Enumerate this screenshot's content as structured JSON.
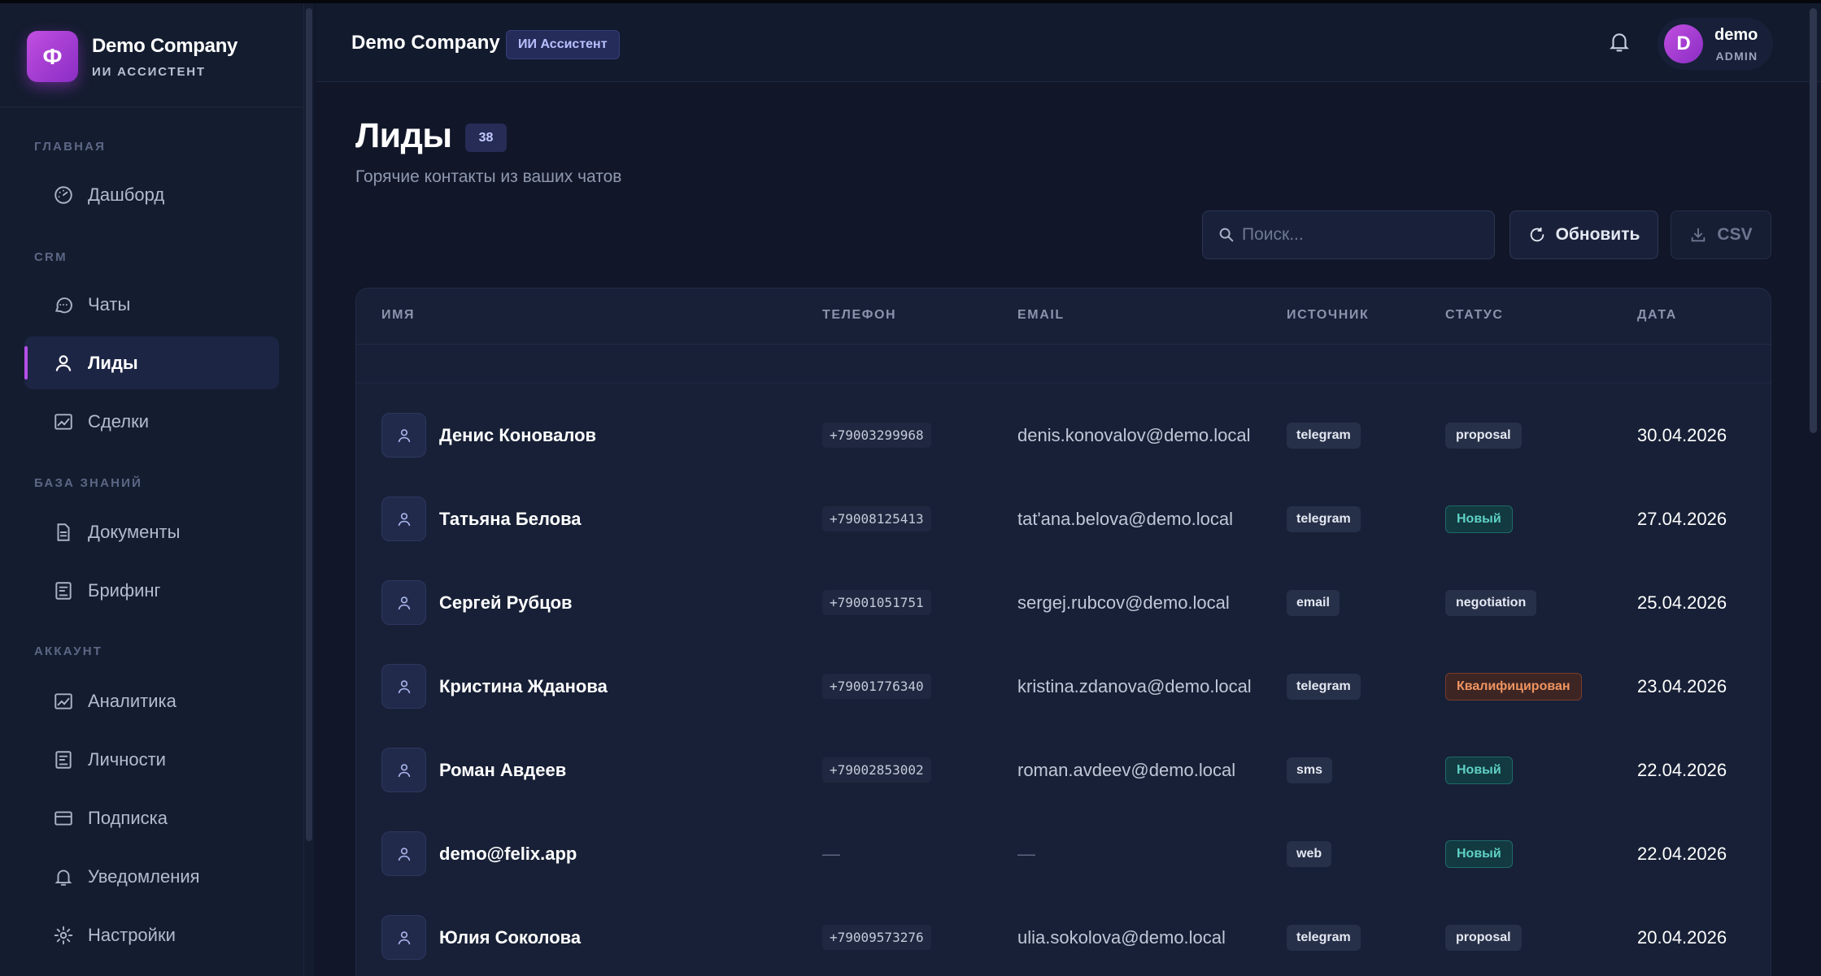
{
  "brand": {
    "logo_letter": "Ф",
    "name": "Demo Company",
    "subtitle": "ИИ АССИСТЕНТ"
  },
  "sidebar": {
    "sections": [
      {
        "title": "ГЛАВНАЯ"
      },
      {
        "title": "CRM"
      },
      {
        "title": "БАЗА ЗНАНИЙ"
      },
      {
        "title": "АККАУНТ"
      }
    ],
    "items": [
      {
        "label": "Дашборд",
        "icon": "gauge-icon"
      },
      {
        "label": "Чаты",
        "icon": "chat-icon"
      },
      {
        "label": "Лиды",
        "icon": "user-icon",
        "active": true
      },
      {
        "label": "Сделки",
        "icon": "chart-icon"
      },
      {
        "label": "Документы",
        "icon": "document-icon"
      },
      {
        "label": "Брифинг",
        "icon": "briefing-icon"
      },
      {
        "label": "Аналитика",
        "icon": "analytics-icon"
      },
      {
        "label": "Личности",
        "icon": "persona-icon"
      },
      {
        "label": "Подписка",
        "icon": "card-icon"
      },
      {
        "label": "Уведомления",
        "icon": "bell-icon"
      },
      {
        "label": "Настройки",
        "icon": "gear-icon"
      }
    ]
  },
  "header": {
    "title": "Demo Company",
    "badge": "ИИ Ассистент",
    "user": {
      "initial": "D",
      "name": "demo",
      "role": "ADMIN"
    }
  },
  "page": {
    "title": "Лиды",
    "count": "38",
    "subtitle": "Горячие контакты из ваших чатов"
  },
  "toolbar": {
    "search_placeholder": "Поиск...",
    "refresh_label": "Обновить",
    "csv_label": "CSV"
  },
  "table": {
    "columns": [
      "ИМЯ",
      "ТЕЛЕФОН",
      "EMAIL",
      "ИСТОЧНИК",
      "СТАТУС",
      "ДАТА"
    ],
    "rows": [
      {
        "name": "Денис Коновалов",
        "phone": "+79003299968",
        "email": "denis.konovalov@demo.local",
        "source": "telegram",
        "status": "proposal",
        "date": "30.04.2026"
      },
      {
        "name": "Татьяна Белова",
        "phone": "+79008125413",
        "email": "tat'ana.belova@demo.local",
        "source": "telegram",
        "status": "Новый",
        "date": "27.04.2026"
      },
      {
        "name": "Сергей Рубцов",
        "phone": "+79001051751",
        "email": "sergej.rubcov@demo.local",
        "source": "email",
        "status": "negotiation",
        "date": "25.04.2026"
      },
      {
        "name": "Кристина Жданова",
        "phone": "+79001776340",
        "email": "kristina.zdanova@demo.local",
        "source": "telegram",
        "status": "Квалифицирован",
        "date": "23.04.2026"
      },
      {
        "name": "Роман Авдеев",
        "phone": "+79002853002",
        "email": "roman.avdeev@demo.local",
        "source": "sms",
        "status": "Новый",
        "date": "22.04.2026"
      },
      {
        "name": "demo@felix.app",
        "phone": "—",
        "email": "—",
        "source": "web",
        "status": "Новый",
        "date": "22.04.2026"
      },
      {
        "name": "Юлия Соколова",
        "phone": "+79009573276",
        "email": "ulia.sokolova@demo.local",
        "source": "telegram",
        "status": "proposal",
        "date": "20.04.2026"
      }
    ]
  },
  "colors": {
    "accent": "#b450e8",
    "status_new": "#5fd0c5",
    "status_qualified": "#ef9460"
  }
}
